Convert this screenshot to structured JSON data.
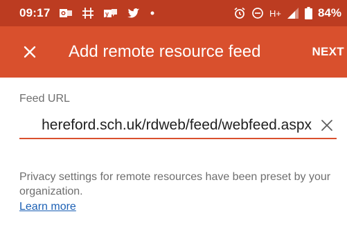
{
  "status_bar": {
    "time": "09:17",
    "battery": "84%",
    "network": "H+",
    "left_icons": [
      "outlook-icon",
      "teams-icon",
      "yammer-icon",
      "twitter-icon",
      "dot-icon"
    ],
    "right_icons": [
      "alarm-icon",
      "do-not-disturb-icon",
      "signal-icon",
      "battery-icon"
    ]
  },
  "app_bar": {
    "title": "Add remote resource feed",
    "next_label": "NEXT",
    "close_icon": "close-icon"
  },
  "form": {
    "feed_url_label": "Feed URL",
    "feed_url_value": "hereford.sch.uk/rdweb/feed/webfeed.aspx",
    "clear_icon": "clear-icon"
  },
  "privacy": {
    "text": "Privacy settings for remote resources have been preset by your organization.",
    "learn_more": "Learn more"
  },
  "colors": {
    "status_bar": "#bc3c21",
    "app_bar": "#d9502d",
    "accent": "#d9502d",
    "link": "#1a5fb4",
    "secondary_text": "#6e6e6e"
  }
}
